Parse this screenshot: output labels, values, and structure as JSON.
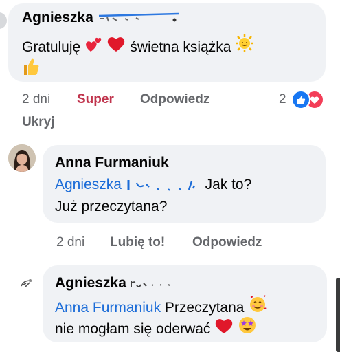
{
  "comment1": {
    "author": "Agnieszka",
    "text_before": "Gratuluję",
    "text_after": "świetna książka",
    "emojis": [
      "two-hearts",
      "red-heart",
      "smiling-sun",
      "thumbs-up"
    ],
    "time": "2 dni",
    "reaction_label": "Super",
    "reply_label": "Odpowiedz",
    "reaction_count": "2",
    "hide_label": "Ukryj",
    "colors": {
      "reaction_active": "#c0344d",
      "like": "#1877f2",
      "love": "#f33e58"
    }
  },
  "reply1": {
    "author": "Anna Furmaniuk",
    "mention": "Agnieszka",
    "text_line1": "Jak to?",
    "text_line2": "Już przeczytana?",
    "time": "2 dni",
    "like_label": "Lubię to!",
    "reply_label": "Odpowiedz"
  },
  "reply2": {
    "author": "Agnieszka",
    "mention": "Anna Furmaniuk",
    "text_line1": "Przeczytana",
    "text_line2": "nie mogłam się oderwać",
    "emojis": [
      "smiling-face-with-hearts",
      "red-heart",
      "star-struck"
    ]
  },
  "theme": {
    "mention_color": "#1b6cd8",
    "bubble_bg": "#f0f2f5",
    "meta_color": "#65676b"
  }
}
